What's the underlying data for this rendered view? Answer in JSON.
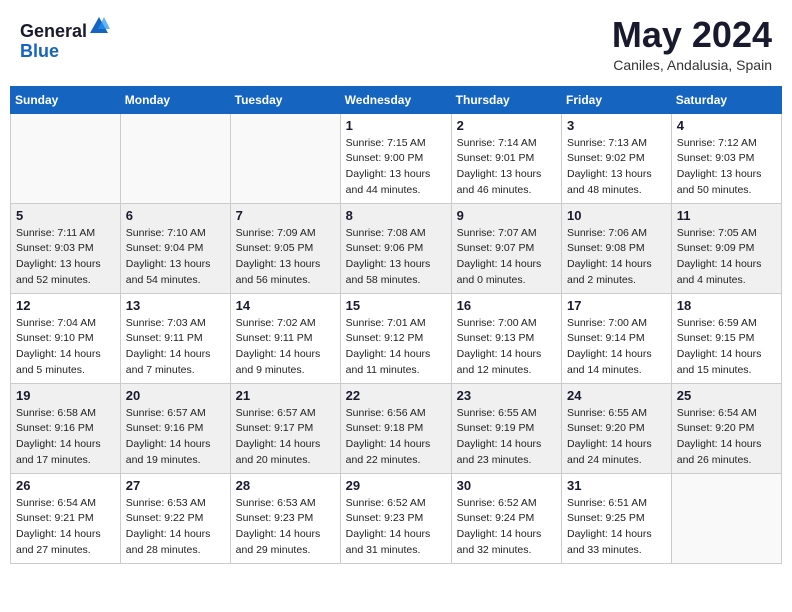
{
  "header": {
    "logo_line1": "General",
    "logo_line2": "Blue",
    "month": "May 2024",
    "location": "Caniles, Andalusia, Spain"
  },
  "weekdays": [
    "Sunday",
    "Monday",
    "Tuesday",
    "Wednesday",
    "Thursday",
    "Friday",
    "Saturday"
  ],
  "weeks": [
    [
      {
        "day": "",
        "info": ""
      },
      {
        "day": "",
        "info": ""
      },
      {
        "day": "",
        "info": ""
      },
      {
        "day": "1",
        "info": "Sunrise: 7:15 AM\nSunset: 9:00 PM\nDaylight: 13 hours\nand 44 minutes."
      },
      {
        "day": "2",
        "info": "Sunrise: 7:14 AM\nSunset: 9:01 PM\nDaylight: 13 hours\nand 46 minutes."
      },
      {
        "day": "3",
        "info": "Sunrise: 7:13 AM\nSunset: 9:02 PM\nDaylight: 13 hours\nand 48 minutes."
      },
      {
        "day": "4",
        "info": "Sunrise: 7:12 AM\nSunset: 9:03 PM\nDaylight: 13 hours\nand 50 minutes."
      }
    ],
    [
      {
        "day": "5",
        "info": "Sunrise: 7:11 AM\nSunset: 9:03 PM\nDaylight: 13 hours\nand 52 minutes."
      },
      {
        "day": "6",
        "info": "Sunrise: 7:10 AM\nSunset: 9:04 PM\nDaylight: 13 hours\nand 54 minutes."
      },
      {
        "day": "7",
        "info": "Sunrise: 7:09 AM\nSunset: 9:05 PM\nDaylight: 13 hours\nand 56 minutes."
      },
      {
        "day": "8",
        "info": "Sunrise: 7:08 AM\nSunset: 9:06 PM\nDaylight: 13 hours\nand 58 minutes."
      },
      {
        "day": "9",
        "info": "Sunrise: 7:07 AM\nSunset: 9:07 PM\nDaylight: 14 hours\nand 0 minutes."
      },
      {
        "day": "10",
        "info": "Sunrise: 7:06 AM\nSunset: 9:08 PM\nDaylight: 14 hours\nand 2 minutes."
      },
      {
        "day": "11",
        "info": "Sunrise: 7:05 AM\nSunset: 9:09 PM\nDaylight: 14 hours\nand 4 minutes."
      }
    ],
    [
      {
        "day": "12",
        "info": "Sunrise: 7:04 AM\nSunset: 9:10 PM\nDaylight: 14 hours\nand 5 minutes."
      },
      {
        "day": "13",
        "info": "Sunrise: 7:03 AM\nSunset: 9:11 PM\nDaylight: 14 hours\nand 7 minutes."
      },
      {
        "day": "14",
        "info": "Sunrise: 7:02 AM\nSunset: 9:11 PM\nDaylight: 14 hours\nand 9 minutes."
      },
      {
        "day": "15",
        "info": "Sunrise: 7:01 AM\nSunset: 9:12 PM\nDaylight: 14 hours\nand 11 minutes."
      },
      {
        "day": "16",
        "info": "Sunrise: 7:00 AM\nSunset: 9:13 PM\nDaylight: 14 hours\nand 12 minutes."
      },
      {
        "day": "17",
        "info": "Sunrise: 7:00 AM\nSunset: 9:14 PM\nDaylight: 14 hours\nand 14 minutes."
      },
      {
        "day": "18",
        "info": "Sunrise: 6:59 AM\nSunset: 9:15 PM\nDaylight: 14 hours\nand 15 minutes."
      }
    ],
    [
      {
        "day": "19",
        "info": "Sunrise: 6:58 AM\nSunset: 9:16 PM\nDaylight: 14 hours\nand 17 minutes."
      },
      {
        "day": "20",
        "info": "Sunrise: 6:57 AM\nSunset: 9:16 PM\nDaylight: 14 hours\nand 19 minutes."
      },
      {
        "day": "21",
        "info": "Sunrise: 6:57 AM\nSunset: 9:17 PM\nDaylight: 14 hours\nand 20 minutes."
      },
      {
        "day": "22",
        "info": "Sunrise: 6:56 AM\nSunset: 9:18 PM\nDaylight: 14 hours\nand 22 minutes."
      },
      {
        "day": "23",
        "info": "Sunrise: 6:55 AM\nSunset: 9:19 PM\nDaylight: 14 hours\nand 23 minutes."
      },
      {
        "day": "24",
        "info": "Sunrise: 6:55 AM\nSunset: 9:20 PM\nDaylight: 14 hours\nand 24 minutes."
      },
      {
        "day": "25",
        "info": "Sunrise: 6:54 AM\nSunset: 9:20 PM\nDaylight: 14 hours\nand 26 minutes."
      }
    ],
    [
      {
        "day": "26",
        "info": "Sunrise: 6:54 AM\nSunset: 9:21 PM\nDaylight: 14 hours\nand 27 minutes."
      },
      {
        "day": "27",
        "info": "Sunrise: 6:53 AM\nSunset: 9:22 PM\nDaylight: 14 hours\nand 28 minutes."
      },
      {
        "day": "28",
        "info": "Sunrise: 6:53 AM\nSunset: 9:23 PM\nDaylight: 14 hours\nand 29 minutes."
      },
      {
        "day": "29",
        "info": "Sunrise: 6:52 AM\nSunset: 9:23 PM\nDaylight: 14 hours\nand 31 minutes."
      },
      {
        "day": "30",
        "info": "Sunrise: 6:52 AM\nSunset: 9:24 PM\nDaylight: 14 hours\nand 32 minutes."
      },
      {
        "day": "31",
        "info": "Sunrise: 6:51 AM\nSunset: 9:25 PM\nDaylight: 14 hours\nand 33 minutes."
      },
      {
        "day": "",
        "info": ""
      }
    ]
  ]
}
